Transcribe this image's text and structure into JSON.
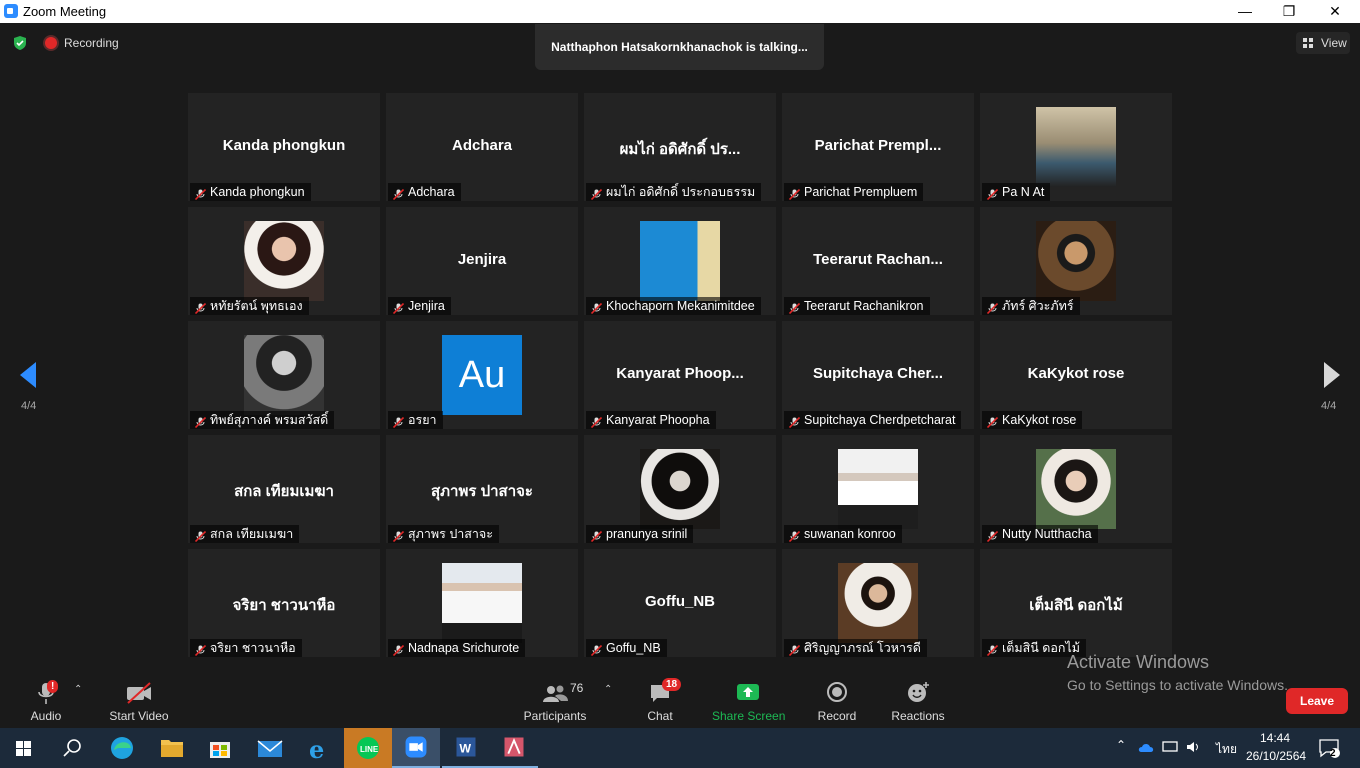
{
  "window": {
    "title": "Zoom Meeting",
    "minimize": "—",
    "maximize": "❐",
    "close": "✕"
  },
  "topbar": {
    "recording": "Recording",
    "talking": "Natthaphon Hatsakornkhanachok is talking...",
    "view": "View"
  },
  "pager": {
    "left": "4/4",
    "right": "4/4"
  },
  "tiles": [
    {
      "big": "Kanda phongkun",
      "label": "Kanda phongkun"
    },
    {
      "big": "Adchara",
      "label": "Adchara"
    },
    {
      "big": "ผมไก่ อดิศักดิ์ ปร...",
      "label": "ผมไก่ อดิศักดิ์ ประกอบธรรม"
    },
    {
      "big": "Parichat  Prempl...",
      "label": "Parichat Prempluem"
    },
    {
      "big": "",
      "label": "Pa N At",
      "photo": "room"
    },
    {
      "big": "",
      "label": "หทัยรัตน์ พุทธเอง",
      "photo": "girl-red"
    },
    {
      "big": "Jenjira",
      "label": "Jenjira"
    },
    {
      "big": "",
      "label": "Khochaporn Mekanimitdee",
      "photo": "rmutt"
    },
    {
      "big": "Teerarut  Rachan...",
      "label": "Teerarut Rachanikron"
    },
    {
      "big": "",
      "label": "ภัทร์ ศิวะภัทร์",
      "photo": "man"
    },
    {
      "big": "",
      "label": "ทิพย์สุภางค์ พรมสวัสดิ์",
      "photo": "girl-bw"
    },
    {
      "big": "",
      "label": "อรยา",
      "au": "Au"
    },
    {
      "big": "Kanyarat  Phoop...",
      "label": "Kanyarat Phoopha"
    },
    {
      "big": "Supitchaya  Cher...",
      "label": "Supitchaya Cherdpetcharat"
    },
    {
      "big": "KaKykot rose",
      "label": "KaKykot rose"
    },
    {
      "big": "สกล เทียมเมฆา",
      "label": "สกล เทียมเมฆา"
    },
    {
      "big": "สุภาพร ปาสาจะ",
      "label": "สุภาพร ปาสาจะ"
    },
    {
      "big": "",
      "label": "pranunya srinil",
      "photo": "girl-dark"
    },
    {
      "big": "",
      "label": "suwanan konroo",
      "photo": "uniform"
    },
    {
      "big": "",
      "label": "Nutty Nutthacha",
      "photo": "garden"
    },
    {
      "big": "จริยา ชาวนาหือ",
      "label": "จริยา ชาวนาหือ"
    },
    {
      "big": "",
      "label": "Nadnapa Srichurote",
      "photo": "student"
    },
    {
      "big": "Goffu_NB",
      "label": "Goffu_NB"
    },
    {
      "big": "",
      "label": "ศิริญญาภรณ์ โวหารดี",
      "photo": "portrait"
    },
    {
      "big": "เต็มสินี ดอกไม้",
      "label": "เต็มสินี ดอกไม้"
    }
  ],
  "watermark": {
    "line1": "Activate Windows",
    "line2": "Go to Settings to activate Windows."
  },
  "toolbar": {
    "audio": "Audio",
    "start_video": "Start Video",
    "participants": "Participants",
    "participants_count": "76",
    "chat": "Chat",
    "chat_badge": "18",
    "share_screen": "Share Screen",
    "record": "Record",
    "reactions": "Reactions",
    "leave": "Leave",
    "audio_alert": "!"
  },
  "taskbar": {
    "lang": "ไทย",
    "time": "14:44",
    "date": "26/10/2564",
    "notif": "2"
  },
  "colors": {
    "accent": "#2d8cff",
    "leave": "#e02828",
    "share": "#1db954"
  }
}
